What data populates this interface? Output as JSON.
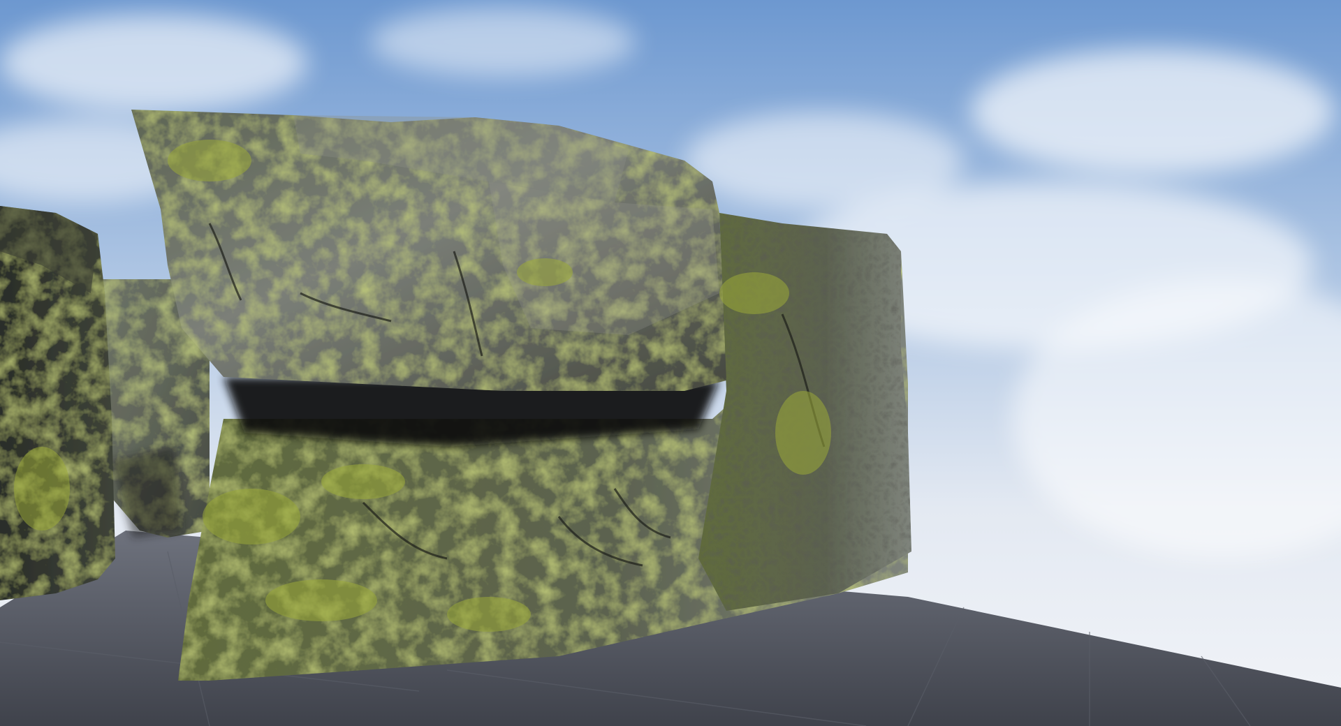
{
  "scene": {
    "description_visible_text": [],
    "colors": {
      "sky_top": "#6f9ad2",
      "sky_mid": "#b8cde6",
      "sky_horizon": "#eef1f6",
      "ground_near": "#4a4d57",
      "ground_far": "#7a7e8a",
      "ground_grid": "#5f636d",
      "rock_dark": "#2c302b",
      "rock_mid": "#5d6154",
      "rock_light": "#8a8e86",
      "moss": "#8a9a2e",
      "moss_light": "#a9b54a",
      "shadow": "#0d0f10"
    }
  }
}
